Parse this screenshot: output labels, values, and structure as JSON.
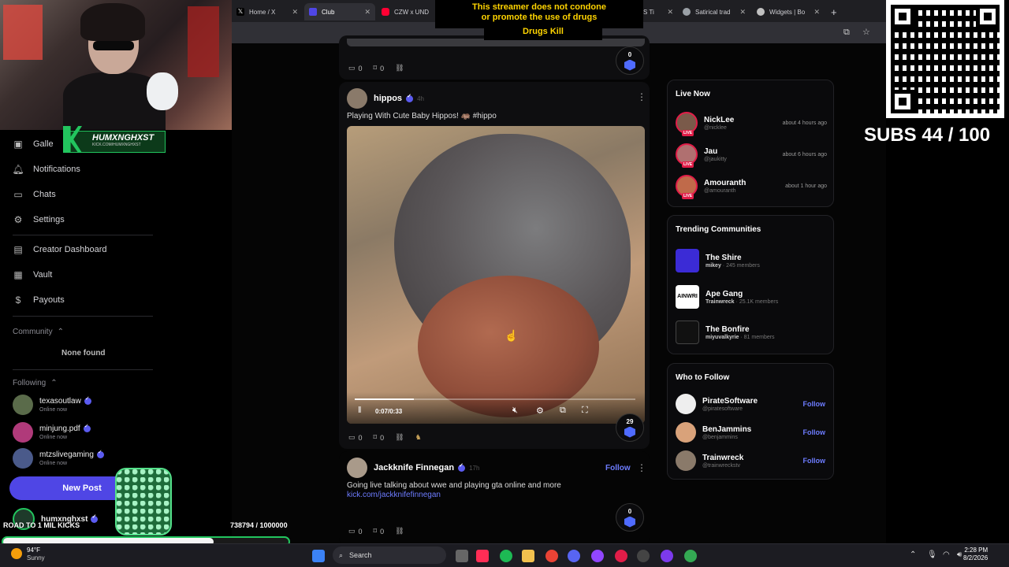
{
  "browser": {
    "tabs": [
      {
        "label": "Home / X",
        "icon": "x-logo-icon",
        "color": "#ffffff"
      },
      {
        "label": "Club",
        "icon": "club-icon",
        "color": "#4f46e5",
        "active": true
      },
      {
        "label": "CZW x UND",
        "icon": "youtube-icon",
        "color": "#ff0033"
      },
      {
        "label": "S Ti",
        "icon": "tab-icon",
        "color": "#888888"
      },
      {
        "label": "Satirical trad",
        "icon": "globe-icon",
        "color": "#9aa0a6"
      },
      {
        "label": "Widgets | Bo",
        "icon": "widgets-icon",
        "color": "#c0c0c0"
      }
    ],
    "new_tab": "+"
  },
  "stream_overlay": {
    "warning_line1": "This streamer does not condone",
    "warning_line2": "or promote the use of drugs",
    "warning_line3": "Drugs Kill",
    "subs_text": "SUBS 44 / 100",
    "goal_label": "ROAD TO 1 MIL KICKS",
    "goal_count": "738794 / 1000000",
    "goal_progress": 0.7388,
    "watermark_name": "HUMXNGHXST",
    "watermark_url": "KICK.COM/HUMXNGHXST"
  },
  "sidebar": {
    "items": [
      {
        "label": "Galle",
        "icon": "gallery-icon"
      },
      {
        "label": "Notifications",
        "icon": "bell-icon"
      },
      {
        "label": "Chats",
        "icon": "chat-icon"
      },
      {
        "label": "Settings",
        "icon": "gear-icon"
      },
      {
        "label": "Creator Dashboard",
        "icon": "dashboard-icon"
      },
      {
        "label": "Vault",
        "icon": "vault-icon"
      },
      {
        "label": "Payouts",
        "icon": "payouts-icon"
      }
    ],
    "community_label": "Community",
    "community_empty": "None found",
    "following_label": "Following",
    "following": [
      {
        "name": "texasoutlaw",
        "status": "Online now",
        "color": "#5a6b4a"
      },
      {
        "name": "minjung.pdf",
        "status": "Online now",
        "color": "#b03a7a"
      },
      {
        "name": "mtzslivegaming",
        "status": "Online now",
        "color": "#4a5a8a"
      }
    ],
    "new_post": "New Post",
    "current_user": "humxnghxst"
  },
  "feed": {
    "top_post": {
      "comments": "0",
      "bookmarks": "0",
      "votes": "0"
    },
    "post1": {
      "author": "hippos",
      "time": "4h",
      "text": "Playing With Cute Baby Hippos! 🦛 #hippo",
      "video_time": "0:07/0:33",
      "video_progress": 0.212,
      "comments": "0",
      "bookmarks": "0",
      "votes": "29"
    },
    "post2": {
      "author": "Jackknife Finnegan",
      "time": "17h",
      "follow": "Follow",
      "text": "Going live talking about wwe and playing gta online and more",
      "link": "kick.com/jackknifefinnegan",
      "comments": "0",
      "bookmarks": "0",
      "votes": "0"
    }
  },
  "live_now": {
    "title": "Live Now",
    "badge": "LIVE",
    "items": [
      {
        "name": "NickLee",
        "handle": "@nicklee",
        "time": "about 4 hours ago",
        "color": "#7a5a4a"
      },
      {
        "name": "Jau",
        "handle": "@jaukitty",
        "time": "about 6 hours ago",
        "color": "#b07070"
      },
      {
        "name": "Amouranth",
        "handle": "@amouranth",
        "time": "about 1 hour ago",
        "color": "#c06a4a"
      }
    ]
  },
  "trending": {
    "title": "Trending Communities",
    "items": [
      {
        "name": "The Shire",
        "owner": "mikey",
        "members": "245 members",
        "color": "#3b2bd6"
      },
      {
        "name": "Ape Gang",
        "owner": "Trainwreck",
        "members": "25.1K members",
        "color": "#ffffff"
      },
      {
        "name": "The Bonfire",
        "owner": "miyuvalkyrie",
        "members": "81 members",
        "color": "#dddddd"
      }
    ]
  },
  "who_to_follow": {
    "title": "Who to Follow",
    "follow": "Follow",
    "items": [
      {
        "name": "PirateSoftware",
        "handle": "@piratesoftware",
        "color": "#eeeeee"
      },
      {
        "name": "BenJammins",
        "handle": "@benjammins",
        "color": "#d9a27a"
      },
      {
        "name": "Trainwreck",
        "handle": "@trainwreckstv",
        "color": "#8a7a6a"
      }
    ]
  },
  "taskbar": {
    "temp": "94°F",
    "weather": "Sunny",
    "search": "Search",
    "time": "2:28 PM",
    "date": "8/2/2026"
  }
}
